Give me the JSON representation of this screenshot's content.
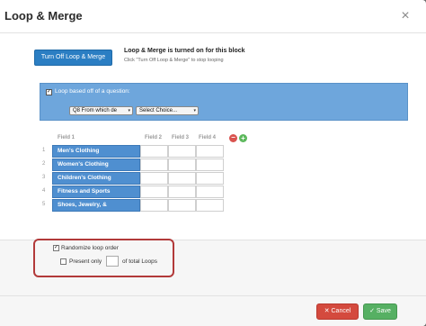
{
  "modal": {
    "title": "Loop & Merge",
    "close_glyph": "×"
  },
  "status": {
    "button_label": "Turn Off Loop & Merge",
    "message": "Loop & Merge is turned on for this block",
    "hint": "Click \"Turn Off Loop & Merge\" to stop looping"
  },
  "question": {
    "checkbox_label": "Loop based off of a question:",
    "question_select": "Q8 From which de",
    "choice_select": "Select Choice..."
  },
  "grid": {
    "headers": [
      "Field 1",
      "Field 2",
      "Field 3",
      "Field 4"
    ],
    "rows": [
      {
        "num": "1",
        "field1": "Men's Clothing"
      },
      {
        "num": "2",
        "field1": "Women's Clothing"
      },
      {
        "num": "3",
        "field1": "Children's Clothing"
      },
      {
        "num": "4",
        "field1": "Fitness and Sports"
      },
      {
        "num": "5",
        "field1": "Shoes, Jewelry, & Accessories"
      }
    ],
    "remove_glyph": "−",
    "add_glyph": "+"
  },
  "options": {
    "randomize_label": "Randomize loop order",
    "randomize_checked": true,
    "present_only_label": "Present only",
    "present_only_checked": false,
    "present_only_value": "",
    "of_total_label": "of total Loops"
  },
  "footer": {
    "cancel_label": "Cancel",
    "save_label": "Save"
  },
  "colors": {
    "primary": "#2b7ec3",
    "panel": "#6ea6dc",
    "cancel": "#d44a3e",
    "save": "#56b063",
    "highlight_outline": "#b23a3a"
  }
}
